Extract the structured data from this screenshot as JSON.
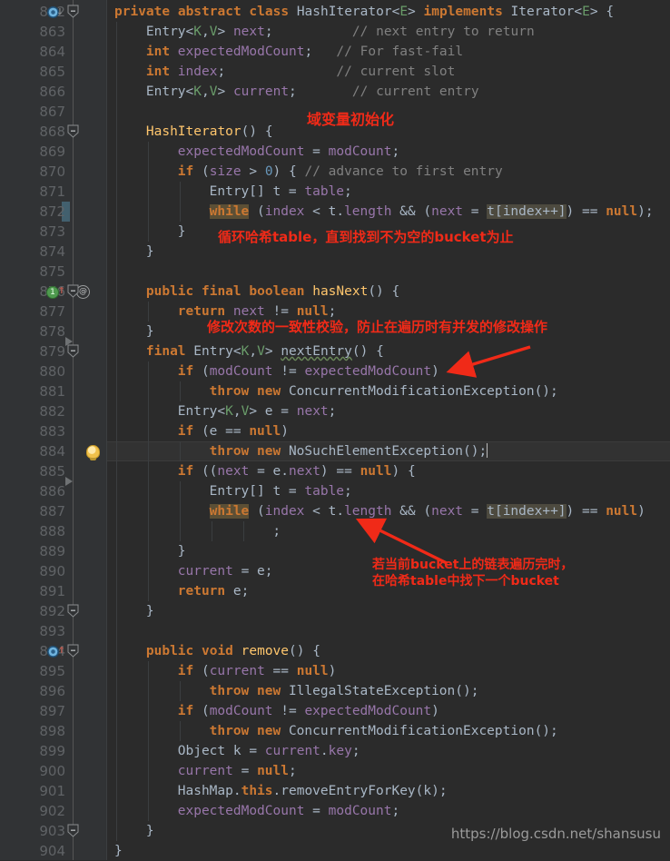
{
  "editor": {
    "theme_bg": "#2b2b2b",
    "gutter_bg": "#313335",
    "current_line_bg": "#323232",
    "accent_keyword": "#cc7832",
    "accent_field": "#9876aa",
    "accent_method": "#ffc66d",
    "accent_comment": "#808080",
    "annotation_color": "#f02a18",
    "first_line": 862,
    "last_line": 904,
    "current_line": 884
  },
  "watermark": "https://blog.csdn.net/shansusu",
  "annotations": [
    {
      "name": "field-init-note",
      "text": "域变量初始化"
    },
    {
      "name": "loop-hash-table-note",
      "text": "循环哈希table，直到找到不为空的bucket为止"
    },
    {
      "name": "modcount-check-note",
      "text": "修改次数的一致性校验，防止在遍历时有并发的修改操作"
    },
    {
      "name": "next-bucket-note-line1",
      "text": "若当前bucket上的链表遍历完时，"
    },
    {
      "name": "next-bucket-note-line2",
      "text": "在哈希table中找下一个bucket"
    }
  ],
  "gutter_icons": [
    {
      "line": 862,
      "icons": [
        "implemented-method-icon",
        "overriding-down-arrow-icon"
      ]
    },
    {
      "line": 876,
      "icons": [
        "usage-count-badge-1",
        "overriding-up-arrow-icon",
        "override-at-icon"
      ]
    },
    {
      "line": 884,
      "icons": [
        "intention-bulb-icon"
      ]
    },
    {
      "line": 894,
      "icons": [
        "implemented-method-icon",
        "overriding-up-arrow-icon"
      ]
    }
  ],
  "usage_badge_count": "1",
  "override_badge": "@",
  "lines": [
    {
      "n": 862,
      "indent": 0,
      "tokens": [
        {
          "t": "private ",
          "c": "kw"
        },
        {
          "t": "abstract ",
          "c": "kw"
        },
        {
          "t": "class ",
          "c": "kw"
        },
        {
          "t": "HashIterator",
          "c": "cls"
        },
        {
          "t": "<",
          "c": "pl"
        },
        {
          "t": "E",
          "c": "gen"
        },
        {
          "t": "> ",
          "c": "pl"
        },
        {
          "t": "implements ",
          "c": "kw"
        },
        {
          "t": "Iterator",
          "c": "cls"
        },
        {
          "t": "<",
          "c": "pl"
        },
        {
          "t": "E",
          "c": "gen"
        },
        {
          "t": "> {",
          "c": "pl"
        }
      ]
    },
    {
      "n": 863,
      "indent": 1,
      "tokens": [
        {
          "t": "Entry",
          "c": "cls"
        },
        {
          "t": "<",
          "c": "pl"
        },
        {
          "t": "K",
          "c": "gen"
        },
        {
          "t": ",",
          "c": "pl"
        },
        {
          "t": "V",
          "c": "gen"
        },
        {
          "t": "> ",
          "c": "pl"
        },
        {
          "t": "next",
          "c": "fld"
        },
        {
          "t": ";",
          "c": "pl"
        },
        {
          "t": "          ",
          "c": "pl"
        },
        {
          "t": "// next entry to return",
          "c": "cmt"
        }
      ]
    },
    {
      "n": 864,
      "indent": 1,
      "tokens": [
        {
          "t": "int ",
          "c": "kw"
        },
        {
          "t": "expectedModCount",
          "c": "fld"
        },
        {
          "t": ";",
          "c": "pl"
        },
        {
          "t": "   ",
          "c": "pl"
        },
        {
          "t": "// For fast-fail",
          "c": "cmt"
        }
      ]
    },
    {
      "n": 865,
      "indent": 1,
      "tokens": [
        {
          "t": "int ",
          "c": "kw"
        },
        {
          "t": "index",
          "c": "fld"
        },
        {
          "t": ";",
          "c": "pl"
        },
        {
          "t": "              ",
          "c": "pl"
        },
        {
          "t": "// current slot",
          "c": "cmt"
        }
      ]
    },
    {
      "n": 866,
      "indent": 1,
      "tokens": [
        {
          "t": "Entry",
          "c": "cls"
        },
        {
          "t": "<",
          "c": "pl"
        },
        {
          "t": "K",
          "c": "gen"
        },
        {
          "t": ",",
          "c": "pl"
        },
        {
          "t": "V",
          "c": "gen"
        },
        {
          "t": "> ",
          "c": "pl"
        },
        {
          "t": "current",
          "c": "fld"
        },
        {
          "t": ";",
          "c": "pl"
        },
        {
          "t": "       ",
          "c": "pl"
        },
        {
          "t": "// current entry",
          "c": "cmt"
        }
      ]
    },
    {
      "n": 867,
      "indent": 1,
      "tokens": []
    },
    {
      "n": 868,
      "indent": 1,
      "tokens": [
        {
          "t": "HashIterator",
          "c": "mth"
        },
        {
          "t": "() {",
          "c": "pl"
        }
      ]
    },
    {
      "n": 869,
      "indent": 2,
      "tokens": [
        {
          "t": "expectedModCount",
          "c": "fld"
        },
        {
          "t": " = ",
          "c": "pl"
        },
        {
          "t": "modCount",
          "c": "fld"
        },
        {
          "t": ";",
          "c": "pl"
        }
      ]
    },
    {
      "n": 870,
      "indent": 2,
      "tokens": [
        {
          "t": "if",
          "c": "kw"
        },
        {
          "t": " (",
          "c": "pl"
        },
        {
          "t": "size",
          "c": "fld"
        },
        {
          "t": " > ",
          "c": "pl"
        },
        {
          "t": "0",
          "c": "num"
        },
        {
          "t": ") { ",
          "c": "pl"
        },
        {
          "t": "// advance to first entry",
          "c": "cmt"
        }
      ]
    },
    {
      "n": 871,
      "indent": 3,
      "tokens": [
        {
          "t": "Entry",
          "c": "cls"
        },
        {
          "t": "[] t = ",
          "c": "pl"
        },
        {
          "t": "table",
          "c": "fld"
        },
        {
          "t": ";",
          "c": "pl"
        }
      ]
    },
    {
      "n": 872,
      "indent": 3,
      "changebar": true,
      "tokens": [
        {
          "t": "while",
          "c": "kwhl"
        },
        {
          "t": " (",
          "c": "pl"
        },
        {
          "t": "index",
          "c": "fld"
        },
        {
          "t": " < t.",
          "c": "pl"
        },
        {
          "t": "length",
          "c": "fld"
        },
        {
          "t": " && (",
          "c": "pl"
        },
        {
          "t": "next",
          "c": "fld"
        },
        {
          "t": " = ",
          "c": "pl"
        },
        {
          "t": "t[index++]",
          "c": "idhl"
        },
        {
          "t": ") == ",
          "c": "pl"
        },
        {
          "t": "null",
          "c": "kw"
        },
        {
          "t": ");",
          "c": "pl"
        }
      ]
    },
    {
      "n": 873,
      "indent": 2,
      "tokens": [
        {
          "t": "}",
          "c": "pl"
        }
      ]
    },
    {
      "n": 874,
      "indent": 1,
      "tokens": [
        {
          "t": "}",
          "c": "pl"
        }
      ]
    },
    {
      "n": 875,
      "indent": 1,
      "tokens": []
    },
    {
      "n": 876,
      "indent": 1,
      "tokens": [
        {
          "t": "public ",
          "c": "kw"
        },
        {
          "t": "final ",
          "c": "kw"
        },
        {
          "t": "boolean ",
          "c": "kw"
        },
        {
          "t": "hasNext",
          "c": "mth"
        },
        {
          "t": "() {",
          "c": "pl"
        }
      ]
    },
    {
      "n": 877,
      "indent": 2,
      "tokens": [
        {
          "t": "return ",
          "c": "kw"
        },
        {
          "t": "next",
          "c": "fld"
        },
        {
          "t": " != ",
          "c": "pl"
        },
        {
          "t": "null",
          "c": "kw"
        },
        {
          "t": ";",
          "c": "pl"
        }
      ]
    },
    {
      "n": 878,
      "indent": 1,
      "tokens": [
        {
          "t": "}",
          "c": "pl"
        }
      ]
    },
    {
      "n": 879,
      "indent": 1,
      "tokens": [
        {
          "t": "final ",
          "c": "kw"
        },
        {
          "t": "Entry",
          "c": "cls"
        },
        {
          "t": "<",
          "c": "pl"
        },
        {
          "t": "K",
          "c": "gen"
        },
        {
          "t": ",",
          "c": "pl"
        },
        {
          "t": "V",
          "c": "gen"
        },
        {
          "t": "> ",
          "c": "pl"
        },
        {
          "t": "nextEntry",
          "c": "err"
        },
        {
          "t": "() {",
          "c": "pl"
        }
      ]
    },
    {
      "n": 880,
      "indent": 2,
      "tokens": [
        {
          "t": "if",
          "c": "kw"
        },
        {
          "t": " (",
          "c": "pl"
        },
        {
          "t": "modCount",
          "c": "fld"
        },
        {
          "t": " != ",
          "c": "pl"
        },
        {
          "t": "expectedModCount",
          "c": "fld"
        },
        {
          "t": ")",
          "c": "pl"
        }
      ]
    },
    {
      "n": 881,
      "indent": 3,
      "tokens": [
        {
          "t": "throw ",
          "c": "kw"
        },
        {
          "t": "new ",
          "c": "kw"
        },
        {
          "t": "ConcurrentModificationException",
          "c": "cls"
        },
        {
          "t": "();",
          "c": "pl"
        }
      ]
    },
    {
      "n": 882,
      "indent": 2,
      "tokens": [
        {
          "t": "Entry",
          "c": "cls"
        },
        {
          "t": "<",
          "c": "pl"
        },
        {
          "t": "K",
          "c": "gen"
        },
        {
          "t": ",",
          "c": "pl"
        },
        {
          "t": "V",
          "c": "gen"
        },
        {
          "t": "> e = ",
          "c": "pl"
        },
        {
          "t": "next",
          "c": "fld"
        },
        {
          "t": ";",
          "c": "pl"
        }
      ]
    },
    {
      "n": 883,
      "indent": 2,
      "tokens": [
        {
          "t": "if",
          "c": "kw"
        },
        {
          "t": " (e == ",
          "c": "pl"
        },
        {
          "t": "null",
          "c": "kw"
        },
        {
          "t": ")",
          "c": "pl"
        }
      ]
    },
    {
      "n": 884,
      "indent": 3,
      "current": true,
      "caret": true,
      "tokens": [
        {
          "t": "throw ",
          "c": "kw"
        },
        {
          "t": "new ",
          "c": "kw"
        },
        {
          "t": "NoSuchElementException",
          "c": "cls"
        },
        {
          "t": "();",
          "c": "pl"
        }
      ]
    },
    {
      "n": 885,
      "indent": 2,
      "tokens": [
        {
          "t": "if",
          "c": "kw"
        },
        {
          "t": " ((",
          "c": "pl"
        },
        {
          "t": "next",
          "c": "fld"
        },
        {
          "t": " = e.",
          "c": "pl"
        },
        {
          "t": "next",
          "c": "fld"
        },
        {
          "t": ") == ",
          "c": "pl"
        },
        {
          "t": "null",
          "c": "kw"
        },
        {
          "t": ") {",
          "c": "pl"
        }
      ]
    },
    {
      "n": 886,
      "indent": 3,
      "tokens": [
        {
          "t": "Entry",
          "c": "cls"
        },
        {
          "t": "[] t = ",
          "c": "pl"
        },
        {
          "t": "table",
          "c": "fld"
        },
        {
          "t": ";",
          "c": "pl"
        }
      ]
    },
    {
      "n": 887,
      "indent": 3,
      "tokens": [
        {
          "t": "while",
          "c": "kwhl"
        },
        {
          "t": " (",
          "c": "pl"
        },
        {
          "t": "index",
          "c": "fld"
        },
        {
          "t": " < t.",
          "c": "pl"
        },
        {
          "t": "length",
          "c": "fld"
        },
        {
          "t": " && (",
          "c": "pl"
        },
        {
          "t": "next",
          "c": "fld"
        },
        {
          "t": " = ",
          "c": "pl"
        },
        {
          "t": "t[index++]",
          "c": "idhl"
        },
        {
          "t": ") == ",
          "c": "pl"
        },
        {
          "t": "null",
          "c": "kw"
        },
        {
          "t": ")",
          "c": "pl"
        }
      ]
    },
    {
      "n": 888,
      "indent": 5,
      "tokens": [
        {
          "t": ";",
          "c": "pl"
        }
      ]
    },
    {
      "n": 889,
      "indent": 2,
      "tokens": [
        {
          "t": "}",
          "c": "pl"
        }
      ]
    },
    {
      "n": 890,
      "indent": 2,
      "tokens": [
        {
          "t": "current",
          "c": "fld"
        },
        {
          "t": " = e;",
          "c": "pl"
        }
      ]
    },
    {
      "n": 891,
      "indent": 2,
      "tokens": [
        {
          "t": "return ",
          "c": "kw"
        },
        {
          "t": "e;",
          "c": "pl"
        }
      ]
    },
    {
      "n": 892,
      "indent": 1,
      "tokens": [
        {
          "t": "}",
          "c": "pl"
        }
      ]
    },
    {
      "n": 893,
      "indent": 1,
      "tokens": []
    },
    {
      "n": 894,
      "indent": 1,
      "tokens": [
        {
          "t": "public ",
          "c": "kw"
        },
        {
          "t": "void ",
          "c": "kw"
        },
        {
          "t": "remove",
          "c": "mth"
        },
        {
          "t": "() {",
          "c": "pl"
        }
      ]
    },
    {
      "n": 895,
      "indent": 2,
      "tokens": [
        {
          "t": "if",
          "c": "kw"
        },
        {
          "t": " (",
          "c": "pl"
        },
        {
          "t": "current",
          "c": "fld"
        },
        {
          "t": " == ",
          "c": "pl"
        },
        {
          "t": "null",
          "c": "kw"
        },
        {
          "t": ")",
          "c": "pl"
        }
      ]
    },
    {
      "n": 896,
      "indent": 3,
      "tokens": [
        {
          "t": "throw ",
          "c": "kw"
        },
        {
          "t": "new ",
          "c": "kw"
        },
        {
          "t": "IllegalStateException",
          "c": "cls"
        },
        {
          "t": "();",
          "c": "pl"
        }
      ]
    },
    {
      "n": 897,
      "indent": 2,
      "tokens": [
        {
          "t": "if",
          "c": "kw"
        },
        {
          "t": " (",
          "c": "pl"
        },
        {
          "t": "modCount",
          "c": "fld"
        },
        {
          "t": " != ",
          "c": "pl"
        },
        {
          "t": "expectedModCount",
          "c": "fld"
        },
        {
          "t": ")",
          "c": "pl"
        }
      ]
    },
    {
      "n": 898,
      "indent": 3,
      "tokens": [
        {
          "t": "throw ",
          "c": "kw"
        },
        {
          "t": "new ",
          "c": "kw"
        },
        {
          "t": "ConcurrentModificationException",
          "c": "cls"
        },
        {
          "t": "();",
          "c": "pl"
        }
      ]
    },
    {
      "n": 899,
      "indent": 2,
      "tokens": [
        {
          "t": "Object",
          "c": "cls"
        },
        {
          "t": " k = ",
          "c": "pl"
        },
        {
          "t": "current",
          "c": "fld"
        },
        {
          "t": ".",
          "c": "pl"
        },
        {
          "t": "key",
          "c": "fld"
        },
        {
          "t": ";",
          "c": "pl"
        }
      ]
    },
    {
      "n": 900,
      "indent": 2,
      "tokens": [
        {
          "t": "current",
          "c": "fld"
        },
        {
          "t": " = ",
          "c": "pl"
        },
        {
          "t": "null",
          "c": "kw"
        },
        {
          "t": ";",
          "c": "pl"
        }
      ]
    },
    {
      "n": 901,
      "indent": 2,
      "tokens": [
        {
          "t": "HashMap",
          "c": "cls"
        },
        {
          "t": ".",
          "c": "pl"
        },
        {
          "t": "this",
          "c": "kw"
        },
        {
          "t": ".",
          "c": "pl"
        },
        {
          "t": "removeEntryForKey",
          "c": "pl"
        },
        {
          "t": "(k);",
          "c": "pl"
        }
      ]
    },
    {
      "n": 902,
      "indent": 2,
      "tokens": [
        {
          "t": "expectedModCount",
          "c": "fld"
        },
        {
          "t": " = ",
          "c": "pl"
        },
        {
          "t": "modCount",
          "c": "fld"
        },
        {
          "t": ";",
          "c": "pl"
        }
      ]
    },
    {
      "n": 903,
      "indent": 1,
      "tokens": [
        {
          "t": "}",
          "c": "pl"
        }
      ]
    },
    {
      "n": 904,
      "indent": 0,
      "tokens": [
        {
          "t": "}",
          "c": "pl"
        }
      ]
    }
  ]
}
